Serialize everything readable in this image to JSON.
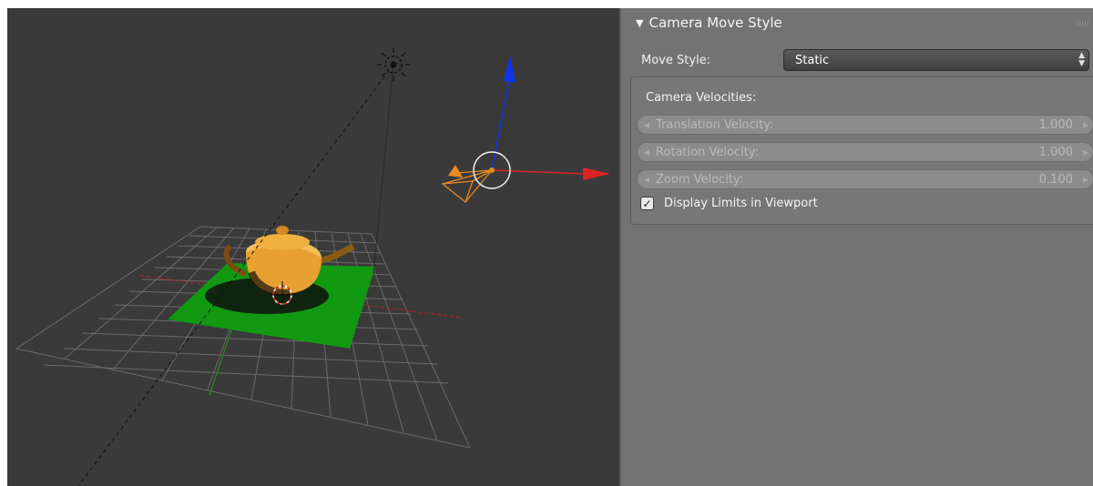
{
  "panel": {
    "header_title": "Camera Move Style",
    "move_style_label": "Move Style:",
    "move_style_value": "Static",
    "velocities_title": "Camera Velocities:",
    "fields": [
      {
        "label": "Translation Velocity:",
        "value": "1.000"
      },
      {
        "label": "Rotation Velocity:",
        "value": "1.000"
      },
      {
        "label": "Zoom Velocity:",
        "value": "0.100"
      }
    ],
    "display_limits_label": "Display Limits in Viewport",
    "display_limits_checked": true
  },
  "viewport": {
    "objects": [
      "lamp-icon",
      "camera",
      "teapot",
      "ground-plane",
      "grid-floor"
    ],
    "colors": {
      "background": "#3a3a3a",
      "plane": "#119911",
      "teapot": "#e8a030",
      "x_axis": "#dd2222",
      "z_axis": "#1133ee"
    }
  }
}
